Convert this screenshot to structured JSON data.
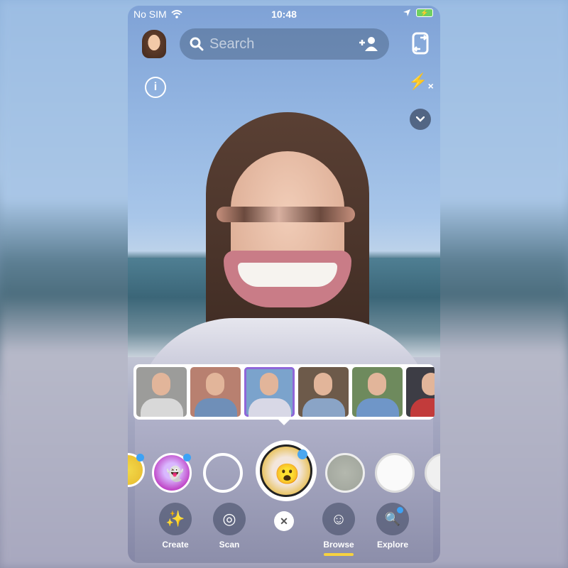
{
  "status_bar": {
    "carrier": "No SIM",
    "time": "10:48",
    "wifi_icon": "wifi-icon",
    "location_icon": "location-arrow-icon",
    "battery_icon": "battery-charging-icon"
  },
  "top_bar": {
    "avatar_icon": "bitmoji-avatar",
    "search_placeholder": "Search",
    "search_icon": "search-icon",
    "add_friend_icon": "add-friend-icon",
    "flip_camera_icon": "flip-camera-icon"
  },
  "camera_controls": {
    "info_icon": "info-icon",
    "info_glyph": "i",
    "flash_icon": "flash-off-icon",
    "flash_glyph": "⚡",
    "flash_off_glyph": "×",
    "more_icon": "chevron-down-icon",
    "more_glyph": "⌄"
  },
  "preview_thumbnails": [
    {
      "label": "Preview person 1",
      "bg": "#9c9c9a",
      "shirt": "#d8d8d8",
      "selected": false
    },
    {
      "label": "Preview person 2",
      "bg": "#b88070",
      "shirt": "#6f8fb8",
      "selected": false
    },
    {
      "label": "Preview person 3",
      "bg": "#7ba3cc",
      "shirt": "#d8d8e6",
      "selected": true
    },
    {
      "label": "Preview person 4",
      "bg": "#6d5a4a",
      "shirt": "#8aa4c6",
      "selected": false
    },
    {
      "label": "Preview person 5",
      "bg": "#6e8a5d",
      "shirt": "#6f96c8",
      "selected": false
    },
    {
      "label": "Preview person 6",
      "bg": "#3d3d45",
      "shirt": "#c23b3b",
      "selected": false
    }
  ],
  "lenses": [
    {
      "name": "lens-planet",
      "has_new_dot": true
    },
    {
      "name": "lens-ghost",
      "has_new_dot": true
    },
    {
      "name": "lens-empty",
      "has_new_dot": false
    },
    {
      "name": "lens-selected-cartoon",
      "has_new_dot": false
    },
    {
      "name": "lens-gray-cat",
      "has_new_dot": false
    },
    {
      "name": "lens-white-face",
      "has_new_dot": false
    },
    {
      "name": "lens-partial",
      "has_new_dot": false
    }
  ],
  "bottom_nav": {
    "create": {
      "label": "Create",
      "glyph": "✨"
    },
    "scan": {
      "label": "Scan",
      "glyph": "◎"
    },
    "close_glyph": "✕",
    "browse": {
      "label": "Browse",
      "glyph": "☺",
      "active": true
    },
    "explore": {
      "label": "Explore",
      "glyph": "🔍",
      "has_new_dot": true
    }
  },
  "colors": {
    "active_underline": "#f7d23e",
    "selected_outline": "#8f66d9",
    "new_dot": "#3da2f5"
  }
}
